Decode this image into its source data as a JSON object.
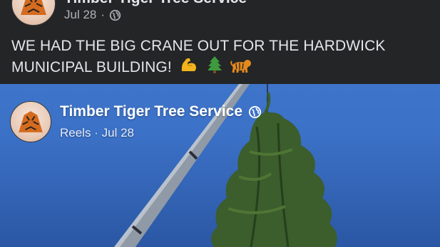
{
  "post": {
    "page_name": "Timber Tiger Tree Service",
    "date": "Jul 28",
    "separator": "·",
    "text": "WE HAD THE BIG CRANE OUT FOR THE HARDWICK MUNICIPAL BUILDING!",
    "emojis": [
      "flexed-biceps",
      "evergreen-tree",
      "tiger"
    ],
    "privacy_icon": "globe-icon"
  },
  "reel": {
    "page_name": "Timber Tiger Tree Service",
    "label": "Reels",
    "separator": "·",
    "date": "Jul 28",
    "privacy_icon": "globe-icon"
  },
  "colors": {
    "header_bg": "#242526",
    "text_primary": "#e4e6eb",
    "text_secondary": "#b0b3b8",
    "sky": "#3b71c7"
  }
}
